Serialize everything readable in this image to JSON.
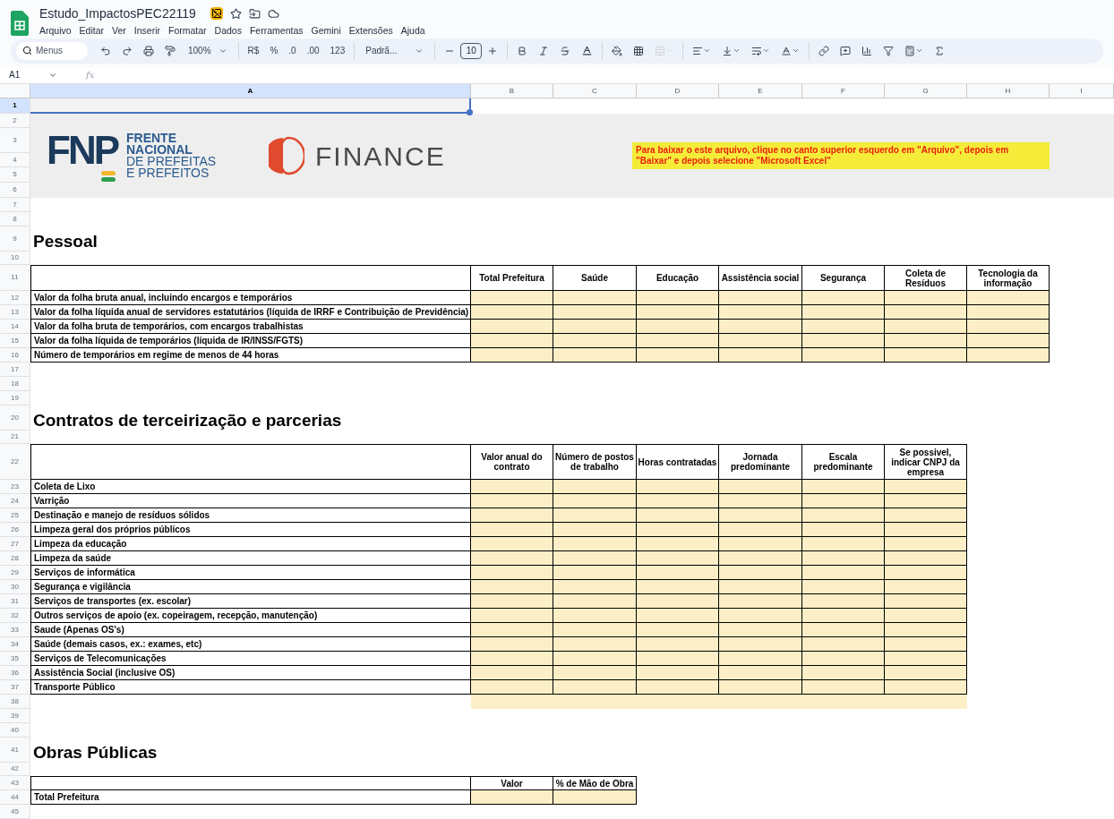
{
  "document": {
    "title": "Estudo_ImpactosPEC22119"
  },
  "menu": [
    "Arquivo",
    "Editar",
    "Ver",
    "Inserir",
    "Formatar",
    "Dados",
    "Ferramentas",
    "Gemini",
    "Extensões",
    "Ajuda"
  ],
  "toolbar": {
    "search_placeholder": "Menus",
    "zoom": "100%",
    "currency": "R$",
    "percent": "%",
    "decrease_decimals": ".0",
    "increase_decimals": ".00",
    "number_format": "123",
    "font": "Padrã...",
    "font_size": "10"
  },
  "formula_bar": {
    "name_box": "A1",
    "fx": "fx"
  },
  "columns": [
    {
      "label": "A",
      "selected": true
    },
    {
      "label": "B",
      "selected": false
    },
    {
      "label": "C",
      "selected": false
    },
    {
      "label": "D",
      "selected": false
    },
    {
      "label": "E",
      "selected": false
    },
    {
      "label": "F",
      "selected": false
    },
    {
      "label": "G",
      "selected": false
    },
    {
      "label": "H",
      "selected": false
    },
    {
      "label": "I",
      "selected": false
    }
  ],
  "row_numbers": [
    {
      "label": "1",
      "selected": true
    },
    {
      "label": "2",
      "selected": false
    },
    {
      "label": "3",
      "selected": false
    },
    {
      "label": "4",
      "selected": false
    },
    {
      "label": "5",
      "selected": false
    },
    {
      "label": "6",
      "selected": false
    },
    {
      "label": "7",
      "selected": false
    },
    {
      "label": "8",
      "selected": false
    },
    {
      "label": "9",
      "selected": false
    },
    {
      "label": "10",
      "selected": false
    },
    {
      "label": "11",
      "selected": false
    },
    {
      "label": "12",
      "selected": false
    },
    {
      "label": "13",
      "selected": false
    },
    {
      "label": "14",
      "selected": false
    },
    {
      "label": "15",
      "selected": false
    },
    {
      "label": "16",
      "selected": false
    },
    {
      "label": "17",
      "selected": false
    },
    {
      "label": "18",
      "selected": false
    },
    {
      "label": "19",
      "selected": false
    },
    {
      "label": "20",
      "selected": false
    },
    {
      "label": "21",
      "selected": false
    },
    {
      "label": "22",
      "selected": false
    },
    {
      "label": "23",
      "selected": false
    },
    {
      "label": "24",
      "selected": false
    },
    {
      "label": "25",
      "selected": false
    },
    {
      "label": "26",
      "selected": false
    },
    {
      "label": "27",
      "selected": false
    },
    {
      "label": "28",
      "selected": false
    },
    {
      "label": "29",
      "selected": false
    },
    {
      "label": "30",
      "selected": false
    },
    {
      "label": "31",
      "selected": false
    },
    {
      "label": "32",
      "selected": false
    },
    {
      "label": "33",
      "selected": false
    },
    {
      "label": "34",
      "selected": false
    },
    {
      "label": "35",
      "selected": false
    },
    {
      "label": "36",
      "selected": false
    },
    {
      "label": "37",
      "selected": false
    },
    {
      "label": "38",
      "selected": false
    },
    {
      "label": "39",
      "selected": false
    },
    {
      "label": "40",
      "selected": false
    },
    {
      "label": "41",
      "selected": false
    },
    {
      "label": "42",
      "selected": false
    },
    {
      "label": "43",
      "selected": false
    },
    {
      "label": "44",
      "selected": false
    },
    {
      "label": "45",
      "selected": false
    }
  ],
  "banner": {
    "fnp_mark": "FNP",
    "fnp_lines": [
      "FRENTE",
      "NACIONAL",
      "DE PREFEITAS",
      "E PREFEITOS"
    ],
    "finance": "FINANCE",
    "note": "Para baixar o este arquivo, clique no canto superior esquerdo em \"Arquivo\", depois em \"Baixar\" e depois selecione \"Microsoft Excel\""
  },
  "sections": [
    {
      "title": "Pessoal",
      "columns": [
        "Total Prefeitura",
        "Saúde",
        "Educação",
        "Assistência social",
        "Segurança",
        "Coleta de Resíduos",
        "Tecnologia da informação"
      ],
      "rows": [
        "Valor da folha bruta anual, incluindo encargos e temporários",
        "Valor da folha líquida anual de servidores estatutários (líquida de IRRF e Contribuição de Previdência)",
        "Valor da folha bruta de temporários, com encargos trabalhistas",
        "Valor da folha líquida de temporários (líquida de IR/INSS/FGTS)",
        "Número de temporários em regime de menos de 44 horas"
      ],
      "fill_row": false
    },
    {
      "title": "Contratos de terceirização e parcerias",
      "columns": [
        "Valor anual do contrato",
        "Número de postos de trabalho",
        "Horas contratadas",
        "Jornada predominante",
        "Escala predominante",
        "Se possivel, indicar CNPJ da empresa"
      ],
      "rows": [
        "Coleta de Lixo",
        "Varrição",
        "Destinação e manejo de resíduos sólidos",
        "Limpeza geral dos próprios públicos",
        "Limpeza da educação",
        "Limpeza da saúde",
        "Serviços de informática",
        "Segurança e vigilância",
        "Serviços de transportes (ex. escolar)",
        "Outros serviços de apoio (ex. copeiragem, recepção, manutenção)",
        "Saude (Apenas OS's)",
        "Saúde (demais casos, ex.: exames, etc)",
        "Serviços de Telecomunicações",
        "Assistência Social (inclusive OS)",
        "Transporte Público"
      ],
      "fill_row": true
    },
    {
      "title": "Obras Públicas",
      "columns": [
        "Valor",
        "% de Mão de Obra"
      ],
      "rows": [
        "Total Prefeitura"
      ],
      "fill_row": false
    }
  ]
}
